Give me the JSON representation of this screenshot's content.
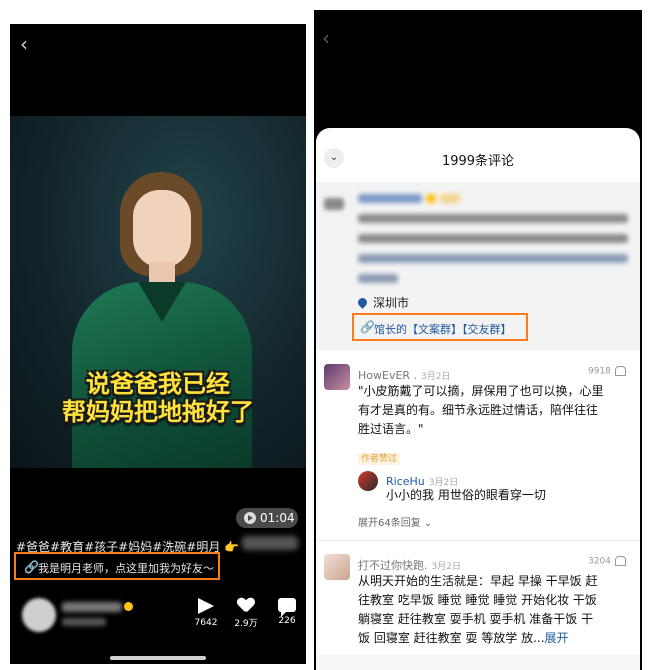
{
  "left_phone": {
    "back_glyph": "‹",
    "video": {
      "caption_line1": "说爸爸我已经",
      "caption_line2": "帮妈妈把地拖好了",
      "duration": "01:04"
    },
    "hashtags": "#爸爸#教育#孩子#妈妈#洗碗#明月",
    "hashtag_emoji": "👉",
    "promo_link_text": "我是明月老师，点这里加我为好友～",
    "actions": {
      "share_count": "7642",
      "like_count": "2.9万",
      "comment_count": "226"
    }
  },
  "right_phone": {
    "back_glyph": "‹",
    "panel": {
      "collapse_glyph": "⌄",
      "title": "1999条评论",
      "pinned": {
        "location": "深圳市",
        "link_text": "馆长的【文案群】【交友群】"
      },
      "comments": [
        {
          "user": "HowEvER .",
          "date": "3月2日",
          "likes": "9918",
          "text": "\"小皮筋戴了可以摘，屏保用了也可以换，心里有才是真的有。细节永远胜过情话，陪伴往往胜过语言。\"",
          "badge": "作者赞过",
          "reply": {
            "user": "RiceHu",
            "date": "3月2日",
            "text": "小小的我 用世俗的眼看穿一切"
          },
          "expand": "展开64条回复"
        },
        {
          "user": "打不过你快跑.",
          "date": "3月2日",
          "likes": "3204",
          "text": "从明天开始的生活就是：早起 早操 干早饭 赶往教室 吃早饭 睡觉 睡觉 睡觉 开始化妆 干饭 躺寝室 赶往教室 耍手机 耍手机 准备干饭 干饭 回寝室 赶往教室 耍 等放学 放...",
          "more": "展开"
        }
      ]
    }
  },
  "colors": {
    "highlight_orange": "#ff7a1a",
    "caption_yellow": "#ffe23b",
    "link_blue": "#1f5aa0"
  }
}
